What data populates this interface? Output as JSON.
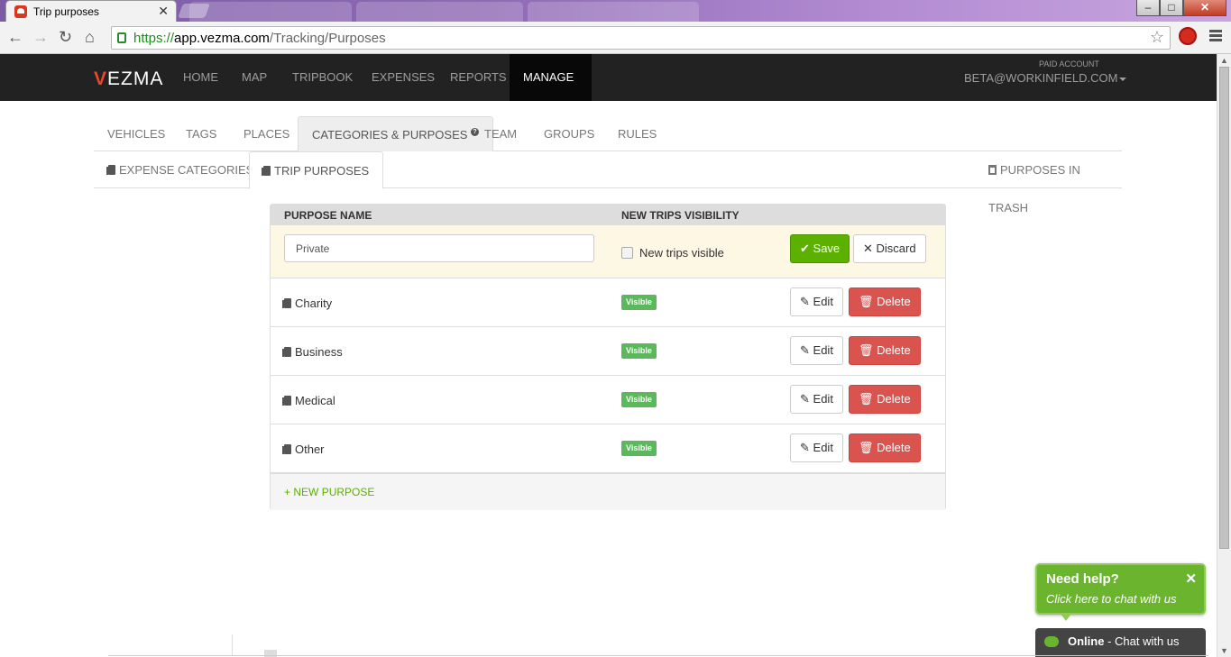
{
  "browser": {
    "tab_title": "Trip purposes",
    "tab_close": "✕",
    "url_scheme": "https://",
    "url_host": "app.vezma.com",
    "url_path": "/Tracking/Purposes",
    "win_min": "–",
    "win_max": "□",
    "win_close": "✕"
  },
  "nav": {
    "logo_v": "V",
    "logo_rest": "EZMA",
    "items": [
      "HOME",
      "MAP",
      "TRIPBOOK",
      "EXPENSES",
      "REPORTS"
    ],
    "manage_label": "MANAGE",
    "account_label": "PAID ACCOUNT",
    "account_email": "BETA@WORKINFIELD.COM"
  },
  "subtabs": {
    "items": [
      "VEHICLES",
      "TAGS",
      "PLACES",
      "CATEGORIES & PURPOSES",
      "TEAM",
      "GROUPS",
      "RULES"
    ],
    "second": [
      "EXPENSE CATEGORIES",
      "TRIP PURPOSES"
    ],
    "trash": "PURPOSES IN TRASH"
  },
  "table": {
    "col_name": "PURPOSE NAME",
    "col_visibility": "NEW TRIPS VISIBILITY",
    "edit_row": {
      "value": "Private",
      "checkbox_label": "New trips visible",
      "save_label": "Save",
      "discard_label": "Discard"
    },
    "rows": [
      {
        "name": "Charity",
        "badge": "Visible"
      },
      {
        "name": "Business",
        "badge": "Visible"
      },
      {
        "name": "Medical",
        "badge": "Visible"
      },
      {
        "name": "Other",
        "badge": "Visible"
      }
    ],
    "edit_label": "Edit",
    "delete_label": "Delete",
    "new_purpose": "NEW PURPOSE"
  },
  "chat": {
    "help_title": "Need help?",
    "help_sub": "Click here to chat with us",
    "close": "✕",
    "status": "Online",
    "status_text": " - Chat with us"
  },
  "colors": {
    "navbar": "#222222",
    "save_green": "#5cb000",
    "delete_red": "#d9534f",
    "badge_green": "#5cb85c",
    "edit_row_bg": "#fcf8e3"
  }
}
